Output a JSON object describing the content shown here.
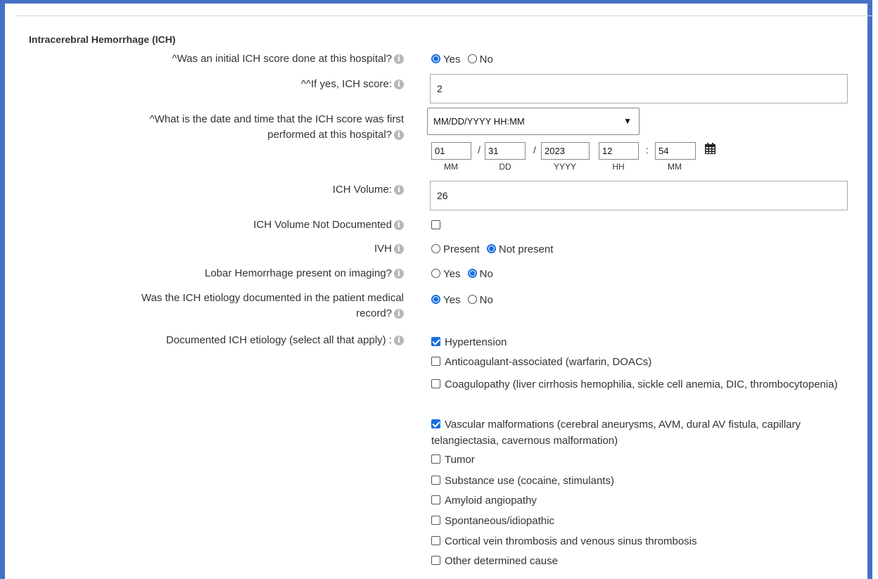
{
  "section_title": "Intracerebral Hemorrhage (ICH)",
  "info_glyph": "i",
  "q_initial_score": {
    "label": "^Was an initial ICH score done at this hospital?",
    "options": [
      "Yes",
      "No"
    ],
    "selected": "Yes"
  },
  "q_ich_score": {
    "label": "^^If yes, ICH score:",
    "value": "2"
  },
  "q_datetime": {
    "label_line1": "^What is the date and time that the ICH score was first",
    "label_line2": "performed at this hospital?",
    "format_select": "MM/DD/YYYY HH:MM",
    "month": "01",
    "day": "31",
    "year": "2023",
    "hour": "12",
    "minute": "54",
    "sep_date": "/",
    "sep_time": ":",
    "labels": [
      "MM",
      "DD",
      "YYYY",
      "HH",
      "MM"
    ]
  },
  "q_volume": {
    "label": "ICH Volume:",
    "value": "26"
  },
  "q_volume_nd": {
    "label": "ICH Volume Not Documented",
    "checked": false
  },
  "q_ivh": {
    "label": "IVH",
    "options": [
      "Present",
      "Not present"
    ],
    "selected": "Not present"
  },
  "q_lobar": {
    "label": "Lobar Hemorrhage present on imaging?",
    "options": [
      "Yes",
      "No"
    ],
    "selected": "No"
  },
  "q_etiology_doc": {
    "label_line1": "Was the ICH etiology documented in the patient medical",
    "label_line2": "record?",
    "options": [
      "Yes",
      "No"
    ],
    "selected": "Yes"
  },
  "q_etiology": {
    "label": "Documented ICH etiology (select all that apply) :",
    "items": [
      {
        "label": "Hypertension",
        "checked": true
      },
      {
        "label": "Anticoagulant-associated (warfarin, DOACs)",
        "checked": false
      },
      {
        "label": "Coagulopathy (liver cirrhosis hemophilia, sickle cell anemia, DIC, thrombocytopenia)",
        "checked": false
      },
      {
        "label": "Vascular malformations (cerebral aneurysms, AVM, dural AV fistula, capillary telangiectasia, cavernous malformation)",
        "checked": true
      },
      {
        "label": "Tumor",
        "checked": false
      },
      {
        "label": "Substance use (cocaine, stimulants)",
        "checked": false
      },
      {
        "label": "Amyloid angiopathy",
        "checked": false
      },
      {
        "label": "Spontaneous/idiopathic",
        "checked": false
      },
      {
        "label": "Cortical vein thrombosis and venous sinus thrombosis",
        "checked": false
      },
      {
        "label": "Other determined cause",
        "checked": false
      }
    ]
  },
  "colors": {
    "accent": "#1a6ee0",
    "frame": "#4472c4"
  }
}
